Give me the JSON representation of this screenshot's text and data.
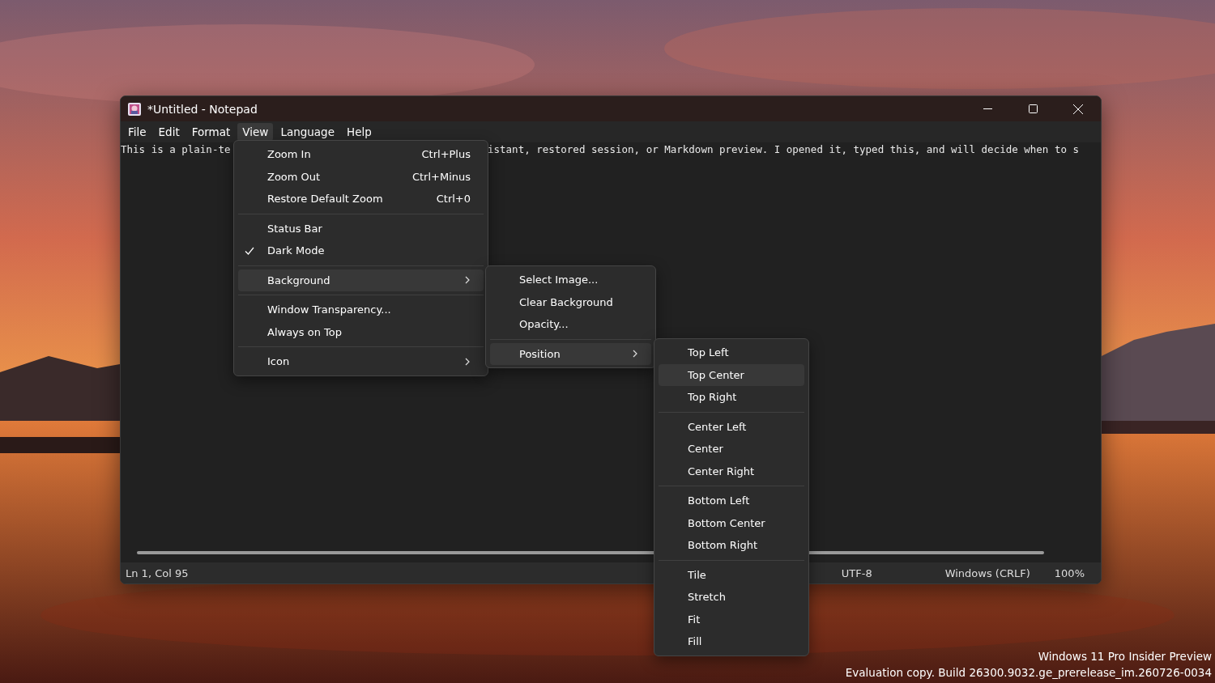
{
  "window": {
    "title": "*Untitled - Notepad"
  },
  "menu_bar": [
    {
      "label": "File",
      "selected": false
    },
    {
      "label": "Edit",
      "selected": false
    },
    {
      "label": "Format",
      "selected": false
    },
    {
      "label": "View",
      "selected": true
    },
    {
      "label": "Language",
      "selected": false
    },
    {
      "label": "Help",
      "selected": false
    }
  ],
  "editor": {
    "text_left": "This is a plain-te",
    "text_right": "istant, restored session, or Markdown preview. I opened it, typed this, and will decide when to s"
  },
  "view_menu": [
    {
      "kind": "item",
      "label": "Zoom In",
      "shortcut": "Ctrl+Plus",
      "checked": false,
      "selected": false
    },
    {
      "kind": "item",
      "label": "Zoom Out",
      "shortcut": "Ctrl+Minus",
      "checked": false,
      "selected": false
    },
    {
      "kind": "item",
      "label": "Restore Default Zoom",
      "shortcut": "Ctrl+0",
      "checked": false,
      "selected": false
    },
    {
      "kind": "separator"
    },
    {
      "kind": "item",
      "label": "Status Bar",
      "checked": false,
      "selected": false
    },
    {
      "kind": "item",
      "label": "Dark Mode",
      "checked": true,
      "selected": false
    },
    {
      "kind": "separator"
    },
    {
      "kind": "item",
      "label": "Background",
      "has_submenu": true,
      "checked": false,
      "selected": true
    },
    {
      "kind": "separator"
    },
    {
      "kind": "item",
      "label": "Window Transparency...",
      "checked": false,
      "selected": false
    },
    {
      "kind": "item",
      "label": "Always on Top",
      "checked": false,
      "selected": false
    },
    {
      "kind": "separator"
    },
    {
      "kind": "item",
      "label": "Icon",
      "has_submenu": true,
      "checked": false,
      "selected": false
    }
  ],
  "background_menu": [
    {
      "kind": "item",
      "label": "Select Image...",
      "selected": false
    },
    {
      "kind": "item",
      "label": "Clear Background",
      "selected": false
    },
    {
      "kind": "item",
      "label": "Opacity...",
      "selected": false
    },
    {
      "kind": "separator"
    },
    {
      "kind": "item",
      "label": "Position",
      "has_submenu": true,
      "selected": true
    }
  ],
  "position_menu": [
    {
      "kind": "item",
      "label": "Top Left",
      "selected": false
    },
    {
      "kind": "item",
      "label": "Top Center",
      "selected": true
    },
    {
      "kind": "item",
      "label": "Top Right",
      "selected": false
    },
    {
      "kind": "separator"
    },
    {
      "kind": "item",
      "label": "Center Left",
      "selected": false
    },
    {
      "kind": "item",
      "label": "Center",
      "selected": false
    },
    {
      "kind": "item",
      "label": "Center Right",
      "selected": false
    },
    {
      "kind": "separator"
    },
    {
      "kind": "item",
      "label": "Bottom Left",
      "selected": false
    },
    {
      "kind": "item",
      "label": "Bottom Center",
      "selected": false
    },
    {
      "kind": "item",
      "label": "Bottom Right",
      "selected": false
    },
    {
      "kind": "separator"
    },
    {
      "kind": "item",
      "label": "Tile",
      "selected": false
    },
    {
      "kind": "item",
      "label": "Stretch",
      "selected": false
    },
    {
      "kind": "item",
      "label": "Fit",
      "selected": false
    },
    {
      "kind": "item",
      "label": "Fill",
      "selected": false
    }
  ],
  "status_bar": {
    "position": "Ln 1, Col 95",
    "encoding": "UTF-8",
    "line_ending": "Windows (CRLF)",
    "zoom": "100%"
  },
  "desktop_watermark": [
    "Windows 11 Pro Insider Preview",
    "Evaluation copy. Build 26300.9032.ge_prerelease_im.260726-0034"
  ]
}
